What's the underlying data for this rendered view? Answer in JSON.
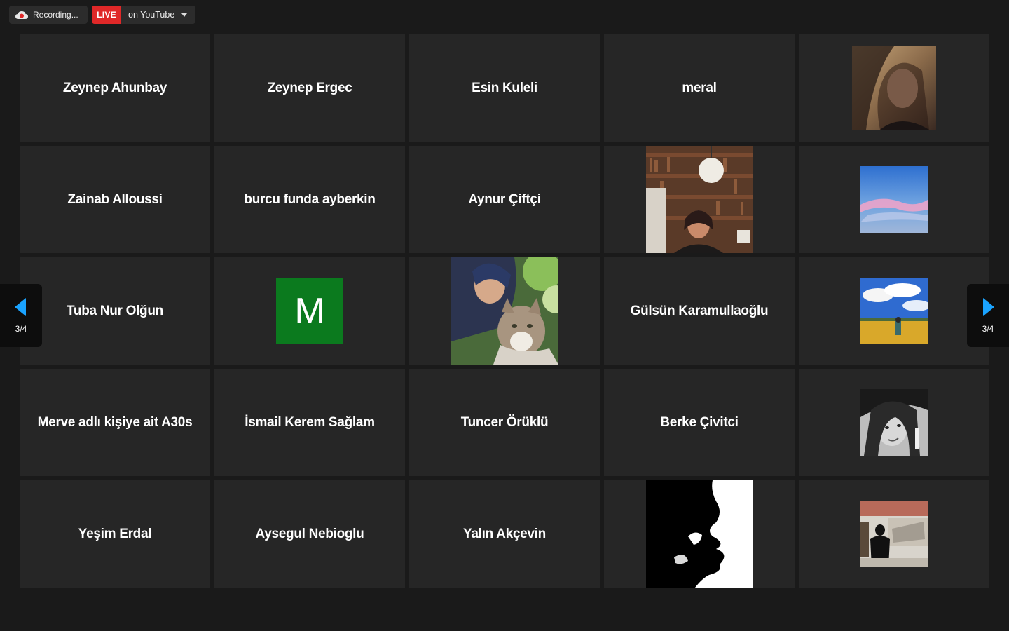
{
  "recording": {
    "label": "Recording...",
    "icon": "cloud-record-icon"
  },
  "live": {
    "badge": "LIVE",
    "destination": "on YouTube"
  },
  "pagination": {
    "left_label": "3/4",
    "right_label": "3/4"
  },
  "tiles": [
    {
      "name": "Zeynep Ahunbay"
    },
    {
      "name": "Zeynep Ergec"
    },
    {
      "name": "Esin Kuleli"
    },
    {
      "name": "meral"
    },
    {
      "video": "young-woman-selfie"
    },
    {
      "name": "Zainab Alloussi"
    },
    {
      "name": "burcu funda ayberkin"
    },
    {
      "name": "Aynur Çiftçi"
    },
    {
      "video": "woman-with-bookshelf"
    },
    {
      "video": "sky-pink-clouds"
    },
    {
      "name": "Tuba Nur Olğun"
    },
    {
      "avatar_letter": "M",
      "avatar_color": "#0b7a1e"
    },
    {
      "video": "woman-with-cat"
    },
    {
      "name": "Gülsün Karamullaoğlu"
    },
    {
      "video": "sunflower-field-sky"
    },
    {
      "name": "Merve adlı kişiye ait A30s"
    },
    {
      "name": "İsmail Kerem Sağlam"
    },
    {
      "name": "Tuncer Örüklü"
    },
    {
      "name": "Berke Çivitci"
    },
    {
      "video": "bw-girl-portrait"
    },
    {
      "name": "Yeşim Erdal"
    },
    {
      "name": "Aysegul Nebioglu"
    },
    {
      "name": "Yalın Akçevin"
    },
    {
      "video": "bw-silhouette-profile"
    },
    {
      "video": "person-in-museum"
    }
  ],
  "colors": {
    "live": "#e02828",
    "arrow": "#1aa3ff",
    "tile": "#262626",
    "background": "#1a1a1a"
  }
}
